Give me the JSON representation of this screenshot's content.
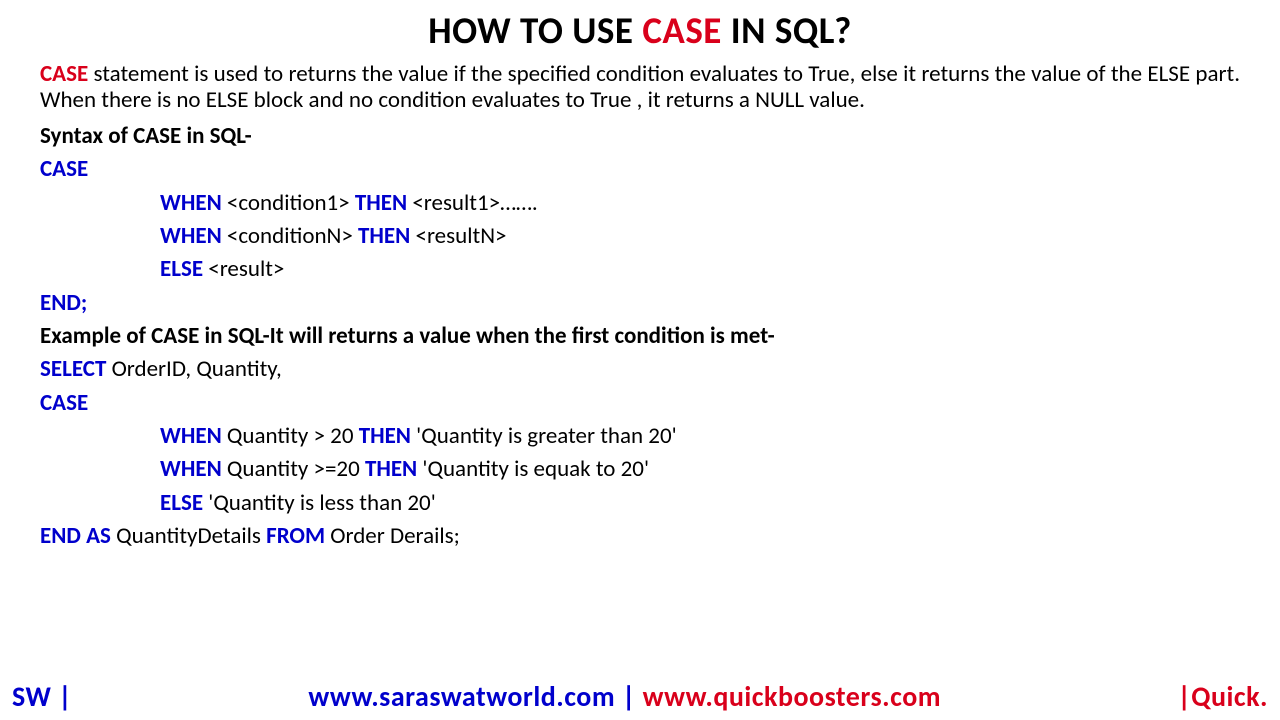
{
  "title": {
    "pre": "HOW TO USE ",
    "kw": "CASE",
    "post": " IN SQL?"
  },
  "desc": {
    "kw": "CASE",
    "text": " statement is used to returns the value if the specified condition evaluates to True, else it returns the  value of the ELSE part. When there is no ELSE block and no condition evaluates to True , it returns a NULL value."
  },
  "syntax_heading": "Syntax of CASE in SQL-",
  "kw": {
    "case": "CASE",
    "when": "WHEN",
    "then": "THEN",
    "else": "ELSE",
    "end": "END;",
    "select": "SELECT",
    "endas": "END AS",
    "from": "FROM"
  },
  "syntax": {
    "cond1": " <condition1> ",
    "res1": " <result1>…….",
    "condn": " <conditionN> ",
    "resn": " <resultN>",
    "elser": " <result>"
  },
  "example_heading": "Example of CASE in SQL-It will returns a value when the first condition is met-",
  "example": {
    "select_cols": " OrderID, Quantity,",
    "w1": " Quantity > 20 ",
    "t1": "  'Quantity is greater than 20'",
    "w2": " Quantity >=20 ",
    "t2": "  'Quantity is equak to 20'",
    "elser": " 'Quantity is less than 20'",
    "alias": " QuantityDetails ",
    "table": " Order Derails;"
  },
  "footer": {
    "left": "SW |",
    "url1": "www.saraswatworld.com",
    "sep": " | ",
    "url2": "www.quickboosters.com",
    "right": "|Quick."
  }
}
